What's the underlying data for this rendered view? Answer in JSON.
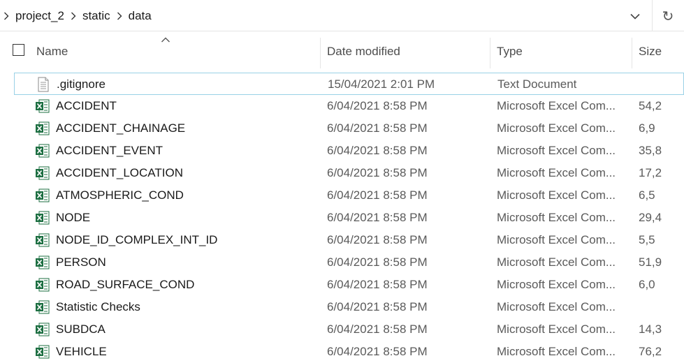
{
  "breadcrumb": {
    "items": [
      "project_2",
      "static",
      "data"
    ]
  },
  "address_bar": {
    "refresh_glyph": "↻",
    "dropdown_icon": "chevron-down-icon"
  },
  "columns": {
    "name": "Name",
    "date_modified": "Date modified",
    "type": "Type",
    "size": "Size"
  },
  "files": [
    {
      "name": ".gitignore",
      "date": "15/04/2021 2:01 PM",
      "type": "Text Document",
      "size": "",
      "icon": "text-file-icon"
    },
    {
      "name": "ACCIDENT",
      "date": "6/04/2021 8:58 PM",
      "type": "Microsoft Excel Com...",
      "size": "54,2",
      "icon": "excel-file-icon"
    },
    {
      "name": "ACCIDENT_CHAINAGE",
      "date": "6/04/2021 8:58 PM",
      "type": "Microsoft Excel Com...",
      "size": "6,9",
      "icon": "excel-file-icon"
    },
    {
      "name": "ACCIDENT_EVENT",
      "date": "6/04/2021 8:58 PM",
      "type": "Microsoft Excel Com...",
      "size": "35,8",
      "icon": "excel-file-icon"
    },
    {
      "name": "ACCIDENT_LOCATION",
      "date": "6/04/2021 8:58 PM",
      "type": "Microsoft Excel Com...",
      "size": "17,2",
      "icon": "excel-file-icon"
    },
    {
      "name": "ATMOSPHERIC_COND",
      "date": "6/04/2021 8:58 PM",
      "type": "Microsoft Excel Com...",
      "size": "6,5",
      "icon": "excel-file-icon"
    },
    {
      "name": "NODE",
      "date": "6/04/2021 8:58 PM",
      "type": "Microsoft Excel Com...",
      "size": "29,4",
      "icon": "excel-file-icon"
    },
    {
      "name": "NODE_ID_COMPLEX_INT_ID",
      "date": "6/04/2021 8:58 PM",
      "type": "Microsoft Excel Com...",
      "size": "5,5",
      "icon": "excel-file-icon"
    },
    {
      "name": "PERSON",
      "date": "6/04/2021 8:58 PM",
      "type": "Microsoft Excel Com...",
      "size": "51,9",
      "icon": "excel-file-icon"
    },
    {
      "name": "ROAD_SURFACE_COND",
      "date": "6/04/2021 8:58 PM",
      "type": "Microsoft Excel Com...",
      "size": "6,0",
      "icon": "excel-file-icon"
    },
    {
      "name": "Statistic Checks",
      "date": "6/04/2021 8:58 PM",
      "type": "Microsoft Excel Com...",
      "size": "",
      "icon": "excel-file-icon"
    },
    {
      "name": "SUBDCA",
      "date": "6/04/2021 8:58 PM",
      "type": "Microsoft Excel Com...",
      "size": "14,3",
      "icon": "excel-file-icon"
    },
    {
      "name": "VEHICLE",
      "date": "6/04/2021 8:58 PM",
      "type": "Microsoft Excel Com...",
      "size": "76,2",
      "icon": "excel-file-icon"
    }
  ],
  "colors": {
    "excel_green": "#1d6f42",
    "selection_outline": "#99d1e6"
  }
}
